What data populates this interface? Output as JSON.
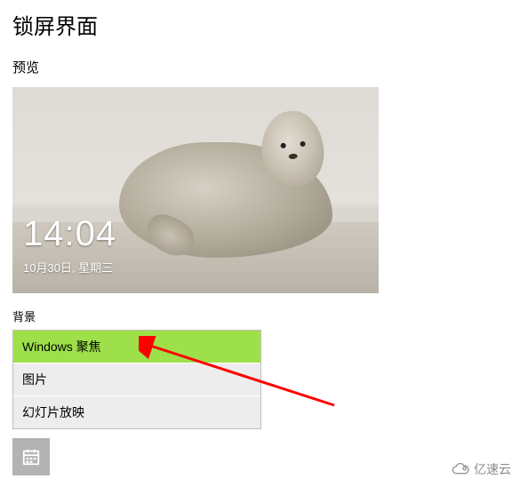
{
  "page": {
    "title": "锁屏界面",
    "preview_label": "预览",
    "background_label": "背景"
  },
  "lockscreen": {
    "time": "14:04",
    "date": "10月30日, 星期三"
  },
  "background_options": {
    "selected_index": 0,
    "items": [
      {
        "label": "Windows 聚焦"
      },
      {
        "label": "图片"
      },
      {
        "label": "幻灯片放映"
      }
    ]
  },
  "app_tile": {
    "icon": "calendar-icon"
  },
  "watermark": {
    "text": "亿速云"
  },
  "annotation": {
    "type": "arrow",
    "color": "#ff0000"
  }
}
